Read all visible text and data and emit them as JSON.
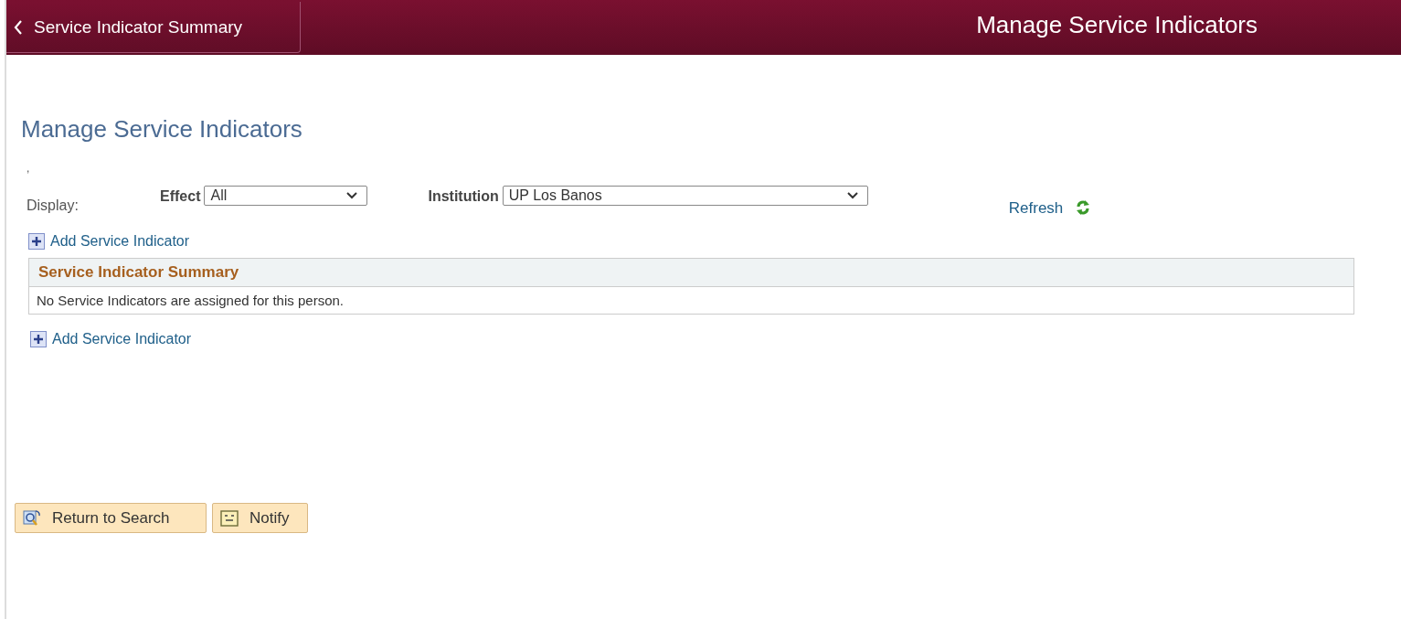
{
  "header": {
    "back_button": "Service Indicator Summary",
    "title": "Manage Service Indicators"
  },
  "page_title": "Manage Service Indicators",
  "stray_mark": ",",
  "display": {
    "label": "Display:",
    "filters": [
      {
        "label": "Effect",
        "value": "All"
      },
      {
        "label": "Institution",
        "value": "UP Los Banos"
      }
    ],
    "refresh": "Refresh"
  },
  "add_links": [
    "Add Service Indicator",
    "Add Service Indicator"
  ],
  "summary": {
    "title": "Service Indicator Summary",
    "message": "No Service Indicators are assigned for this person."
  },
  "buttons": [
    {
      "kind": "search",
      "label": "Return to Search"
    },
    {
      "kind": "notify",
      "label": "Notify"
    }
  ]
}
